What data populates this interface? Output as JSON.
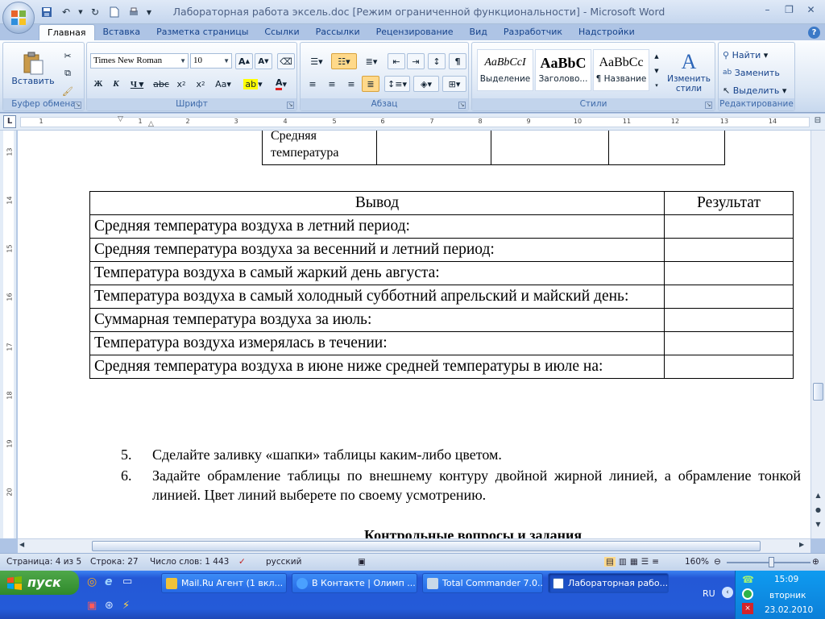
{
  "window": {
    "title": "Лабораторная работа эксель.doc [Режим ограниченной функциональности] - Microsoft Word"
  },
  "tabs": [
    "Главная",
    "Вставка",
    "Разметка страницы",
    "Ссылки",
    "Рассылки",
    "Рецензирование",
    "Вид",
    "Разработчик",
    "Надстройки"
  ],
  "ribbon": {
    "clipboard": {
      "paste": "Вставить",
      "label": "Буфер обмена"
    },
    "font": {
      "name": "Times New Roman",
      "size": "10",
      "label": "Шрифт"
    },
    "paragraph": {
      "label": "Абзац"
    },
    "styles": {
      "label": "Стили",
      "items": [
        {
          "sample": "AaBbCcI",
          "name": "Выделение"
        },
        {
          "sample": "AaBbC",
          "name": "Заголово..."
        },
        {
          "sample": "AaBbCc",
          "name": "¶ Название"
        }
      ],
      "change": "Изменить стили"
    },
    "editing": {
      "find": "Найти",
      "replace": "Заменить",
      "select": "Выделить",
      "label": "Редактирование"
    }
  },
  "ruler": {
    "h": [
      "1",
      "1",
      "2",
      "3",
      "4",
      "5",
      "6",
      "7",
      "8",
      "9",
      "10",
      "11",
      "12",
      "13",
      "14"
    ],
    "v": [
      "13",
      "14",
      "15",
      "16",
      "17",
      "18",
      "19",
      "20"
    ]
  },
  "document": {
    "top_table": {
      "cell": "Средняя температура"
    },
    "main_table": {
      "headers": [
        "Вывод",
        "Результат"
      ],
      "rows": [
        "Средняя температура воздуха в летний период:",
        "Средняя температура воздуха за весенний и летний период:",
        "Температура воздуха в самый жаркий день августа:",
        "Температура воздуха в самый холодный субботний апрельский и майский день:",
        "Суммарная температура воздуха за июль:",
        "Температура воздуха измерялась в течении:",
        "Средняя температура воздуха в июне ниже средней температуры в июле на:"
      ]
    },
    "list": [
      {
        "num": "5.",
        "text": "Сделайте заливку «шапки» таблицы каким-либо цветом."
      },
      {
        "num": "6.",
        "text": "Задайте обрамление таблицы по внешнему контуру двойной жирной линией, а обрамление тонкой линией. Цвет линий выберете по своему усмотрению."
      }
    ],
    "heading": "Контрольные вопросы и задания"
  },
  "status": {
    "page": "Страница: 4 из 5",
    "line": "Строка: 27",
    "words": "Число слов: 1 443",
    "lang": "русский",
    "zoom": "160%"
  },
  "taskbar": {
    "start": "пуск",
    "items": [
      {
        "label": "Mail.Ru Агент (1 вкл..."
      },
      {
        "label": "В Контакте | Олимп ..."
      },
      {
        "label": "Total Commander 7.0..."
      },
      {
        "label": "Лабораторная рабо..."
      }
    ],
    "lang": "RU",
    "time": "15:09",
    "day": "вторник",
    "date": "23.02.2010"
  }
}
